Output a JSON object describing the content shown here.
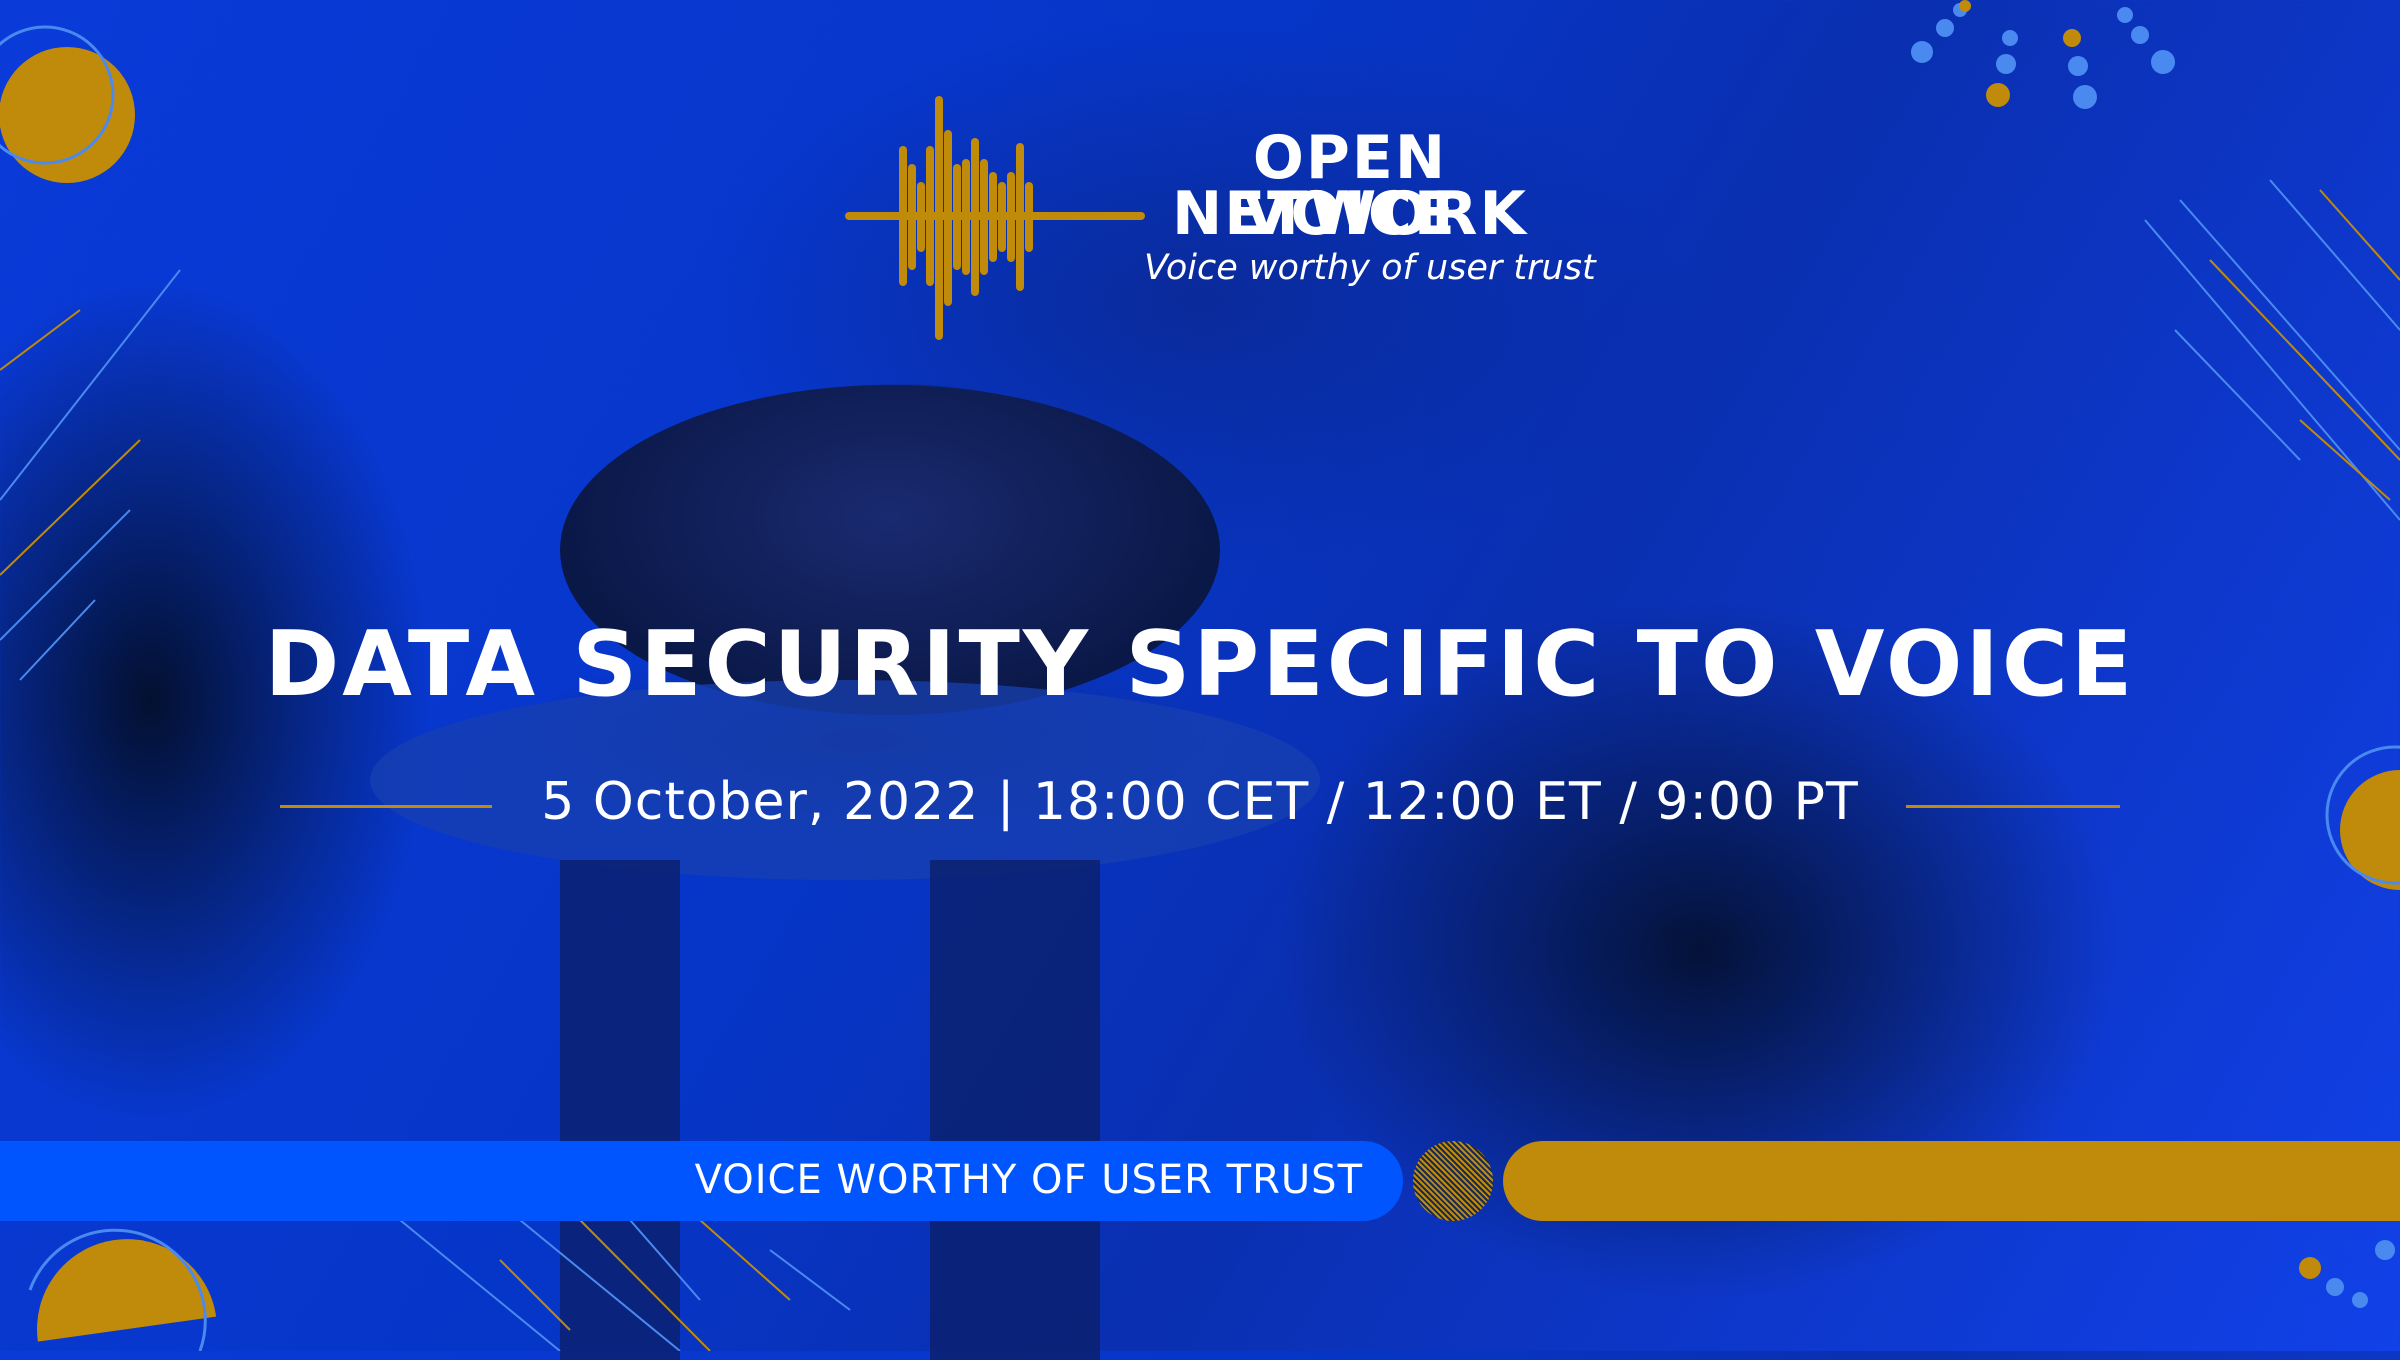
{
  "logo": {
    "line1": "OPEN VOICE",
    "line2": "NETWORK",
    "tagline": "Voice worthy of user trust",
    "icon": "sound-waveform-icon"
  },
  "event": {
    "title": "DATA SECURITY SPECIFIC TO VOICE",
    "datetime": "5 October, 2022 | 18:00 CET / 12:00 ET / 9:00 PT"
  },
  "banner": {
    "text": "VOICE WORTHY OF USER TRUST"
  },
  "colors": {
    "gold": "#c08a0a",
    "blue": "#0055ff",
    "background": "#0a3ad8",
    "light_blue": "#4a8af0"
  }
}
